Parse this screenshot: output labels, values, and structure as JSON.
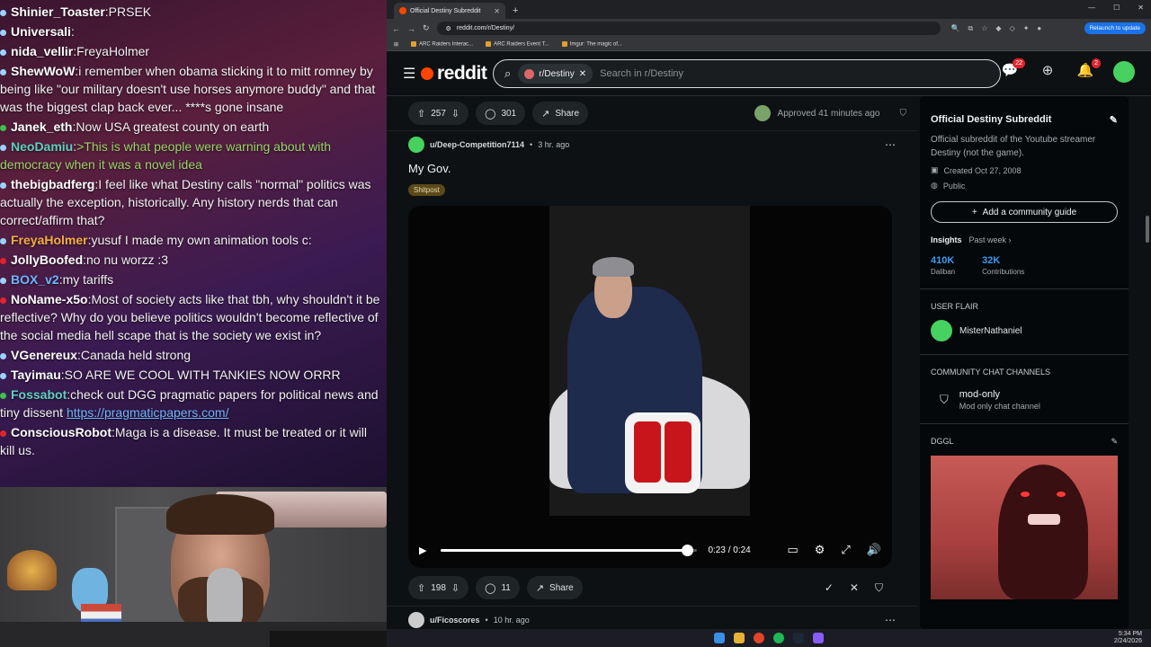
{
  "chat": {
    "messages": [
      {
        "user": "Shinier_Toaster",
        "text": "PRSEK",
        "user_color": "#ffffff",
        "dot": "#9bd3ff",
        "green": false
      },
      {
        "user": "Universali",
        "text": "",
        "user_color": "#ffffff",
        "dot": "#9bd3ff",
        "green": false
      },
      {
        "user": "nida_vellir",
        "text": "FreyaHolmer",
        "user_color": "#ffffff",
        "dot": "#9bd3ff",
        "green": false
      },
      {
        "user": "ShewWoW",
        "text": "i remember when obama sticking it to mitt romney by being like \"our military doesn't use horses anymore buddy\" and that was the biggest clap back ever... ****s gone insane",
        "user_color": "#ffffff",
        "dot": "#9bd3ff",
        "green": false
      },
      {
        "user": "Janek_eth",
        "text": "Now USA greatest county on earth",
        "user_color": "#ffffff",
        "dot": "#3fbf4f",
        "green": false
      },
      {
        "user": "NeoDamiu",
        "text": ">This is what people were warning about with democracy when it was a novel idea",
        "user_color": "#5fd0c0",
        "dot": "#9bd3ff",
        "green": true
      },
      {
        "user": "thebigbadferg",
        "text": "I feel like what Destiny calls \"normal\" politics was actually the exception, historically. Any history nerds that can correct/affirm that?",
        "user_color": "#ffffff",
        "dot": "#9bd3ff",
        "green": false
      },
      {
        "user": "FreyaHolmer",
        "text": "yusuf I made my own animation tools c:",
        "user_color": "#f5b041",
        "dot": "#9bd3ff",
        "green": false
      },
      {
        "user": "JollyBoofed",
        "text": "no nu worzz :3",
        "user_color": "#ffffff",
        "dot": "#e0242e",
        "green": false
      },
      {
        "user": "BOX_v2",
        "text": "my tariffs",
        "user_color": "#6fb5ff",
        "dot": "#9bd3ff",
        "green": false
      },
      {
        "user": "NoName-x5o",
        "text": "Most of society acts like that tbh, why shouldn't it be reflective? Why do you believe politics wouldn't become reflective of the social media hell scape that is the society we exist in?",
        "user_color": "#ffffff",
        "dot": "#e0242e",
        "green": false
      },
      {
        "user": "VGenereux",
        "text": "Canada held strong",
        "user_color": "#ffffff",
        "dot": "#9bd3ff",
        "green": false
      },
      {
        "user": "Tayimau",
        "text": "SO ARE WE COOL WITH TANKIES NOW ORRR",
        "user_color": "#ffffff",
        "dot": "#9bd3ff",
        "green": false
      },
      {
        "user": "Fossabot",
        "text": "check out DGG pragmatic papers for political news and tiny dissent",
        "link": "https://pragmaticpapers.com/",
        "user_color": "#5fd0c0",
        "dot": "#3fbf4f",
        "green": false
      },
      {
        "user": "ConsciousRobot",
        "text": "Maga is a disease. It must be treated or it will kill us.",
        "user_color": "#ffffff",
        "dot": "#e0242e",
        "green": false
      }
    ]
  },
  "browser": {
    "tab_title": "Official Destiny Subreddit",
    "url": "reddit.com/r/Destiny/",
    "relaunch": "Relaunch to update",
    "bookmarks": [
      "ARC Raiders Interac...",
      "ARC Raiders Event T...",
      "Imgur: The magic of..."
    ]
  },
  "reddit": {
    "logo": "reddit",
    "chip": "r/Destiny",
    "search_placeholder": "Search in r/Destiny",
    "chat_badge": "22",
    "notif_badge": "2",
    "post1": {
      "votes": "257",
      "comments": "301",
      "share": "Share",
      "approved": "Approved 41 minutes ago"
    },
    "post2": {
      "user": "u/Deep-Competition7114",
      "time": "3 hr. ago",
      "title": "My Gov.",
      "flair": "Shitpost",
      "video_time": "0:23 / 0:24",
      "progress": 0.96,
      "votes": "198",
      "comments": "11",
      "share": "Share"
    },
    "post3": {
      "user": "u/Ficoscores",
      "time": "10 hr. ago"
    }
  },
  "sidebar": {
    "title": "Official Destiny Subreddit",
    "description": "Official subreddit of the Youtube streamer Destiny (not the game).",
    "created": "Created Oct 27, 2008",
    "visibility": "Public",
    "guide_button": "Add a community guide",
    "insights": "Insights",
    "period": "Past week",
    "stat1_n": "410K",
    "stat1_l": "Daliban",
    "stat2_n": "32K",
    "stat2_l": "Contributions",
    "user_flair_heading": "USER FLAIR",
    "user_flair": "MisterNathaniel",
    "channels_heading": "COMMUNITY CHAT CHANNELS",
    "channel_name": "mod-only",
    "channel_desc": "Mod only chat channel",
    "dggl": "DGGL"
  },
  "taskbar": {
    "time": "5:34 PM",
    "date": "2/24/2026"
  }
}
